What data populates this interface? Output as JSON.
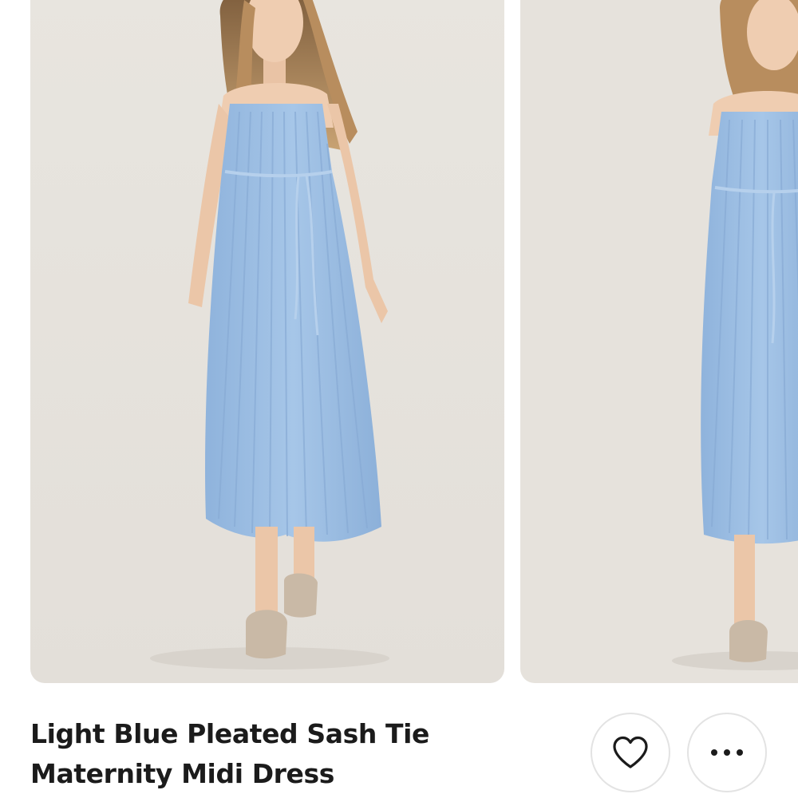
{
  "product": {
    "title": "Light Blue Pleated Sash Tie Maternity Midi Dress"
  },
  "gallery": {
    "images": [
      {
        "alt": "model wearing light blue pleated maternity midi dress, front view"
      },
      {
        "alt": "model wearing light blue pleated maternity midi dress, second view"
      }
    ]
  },
  "actions": {
    "like_icon": "heart-outline-icon",
    "more_icon": "more-horizontal-icon"
  },
  "colors": {
    "backdrop": "#e6e2dc",
    "dress": "#9dbfe3",
    "text": "#1b1b1b",
    "button_border": "#e3e3e3"
  }
}
